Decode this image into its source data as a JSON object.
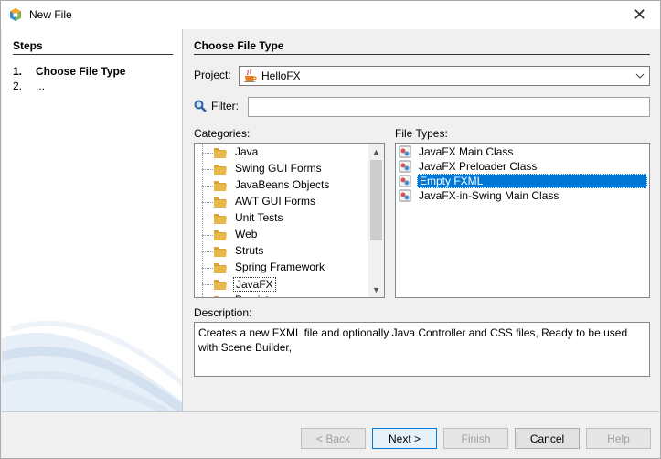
{
  "window": {
    "title": "New File",
    "close_glyph": "✕"
  },
  "steps": {
    "title": "Steps",
    "items": [
      {
        "num": "1.",
        "label": "Choose File Type"
      },
      {
        "num": "2.",
        "label": "..."
      }
    ]
  },
  "main": {
    "title": "Choose File Type",
    "project_label": "Project:",
    "project_value": "HelloFX",
    "project_icon": "coffee-cup-icon",
    "filter_label": "Filter:",
    "filter_value": "",
    "filter_icon": "magnifier-icon",
    "categories_label": "Categories:",
    "categories": [
      "Java",
      "Swing GUI Forms",
      "JavaBeans Objects",
      "AWT GUI Forms",
      "Unit Tests",
      "Web",
      "Struts",
      "Spring Framework",
      "JavaFX",
      "Persist"
    ],
    "selected_category": "JavaFX",
    "filetypes_label": "File Types:",
    "filetypes": [
      "JavaFX Main Class",
      "JavaFX Preloader Class",
      "Empty FXML",
      "JavaFX-in-Swing Main Class"
    ],
    "selected_filetype": "Empty FXML",
    "description_label": "Description:",
    "description": "Creates a new FXML file and optionally Java Controller and CSS files, Ready to be used with Scene Builder,"
  },
  "buttons": {
    "back": "< Back",
    "next": "Next >",
    "finish": "Finish",
    "cancel": "Cancel",
    "help": "Help"
  },
  "colors": {
    "selection": "#0078d7",
    "folder": "#e8b84a"
  }
}
